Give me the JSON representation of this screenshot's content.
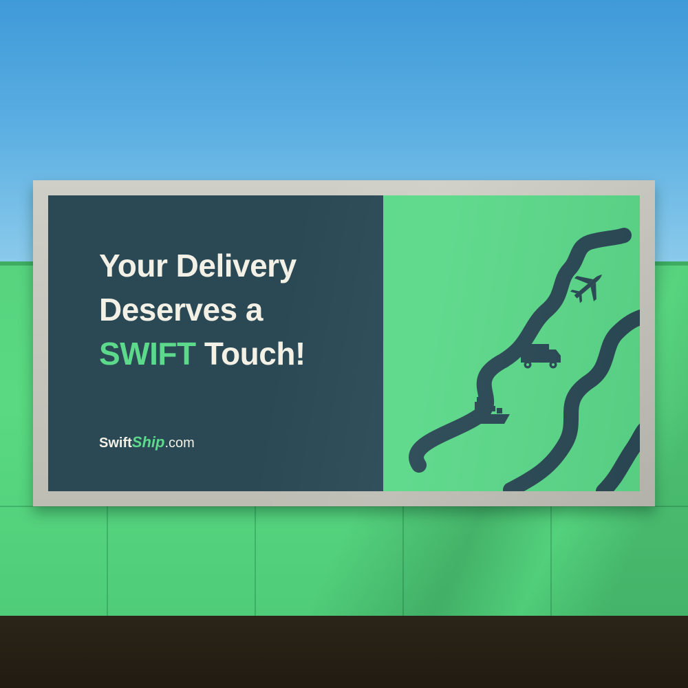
{
  "billboard": {
    "headline": {
      "line1": "Your Delivery",
      "line2": "Deserves a",
      "line3_accent": "SWIFT",
      "line3_rest": " Touch!"
    },
    "brand": {
      "part1": "Swift",
      "part2": "Ship",
      "part3": ".com"
    },
    "icons": [
      "airplane-icon",
      "delivery-van-icon",
      "cargo-ship-icon"
    ]
  },
  "colors": {
    "sky": "#4aa3dc",
    "wall_green": "#57d37e",
    "panel_dark": "#2a4955",
    "panel_green": "#5cd98a",
    "text_cream": "#f3f1e6",
    "frame_gray": "#c8c8c0"
  }
}
